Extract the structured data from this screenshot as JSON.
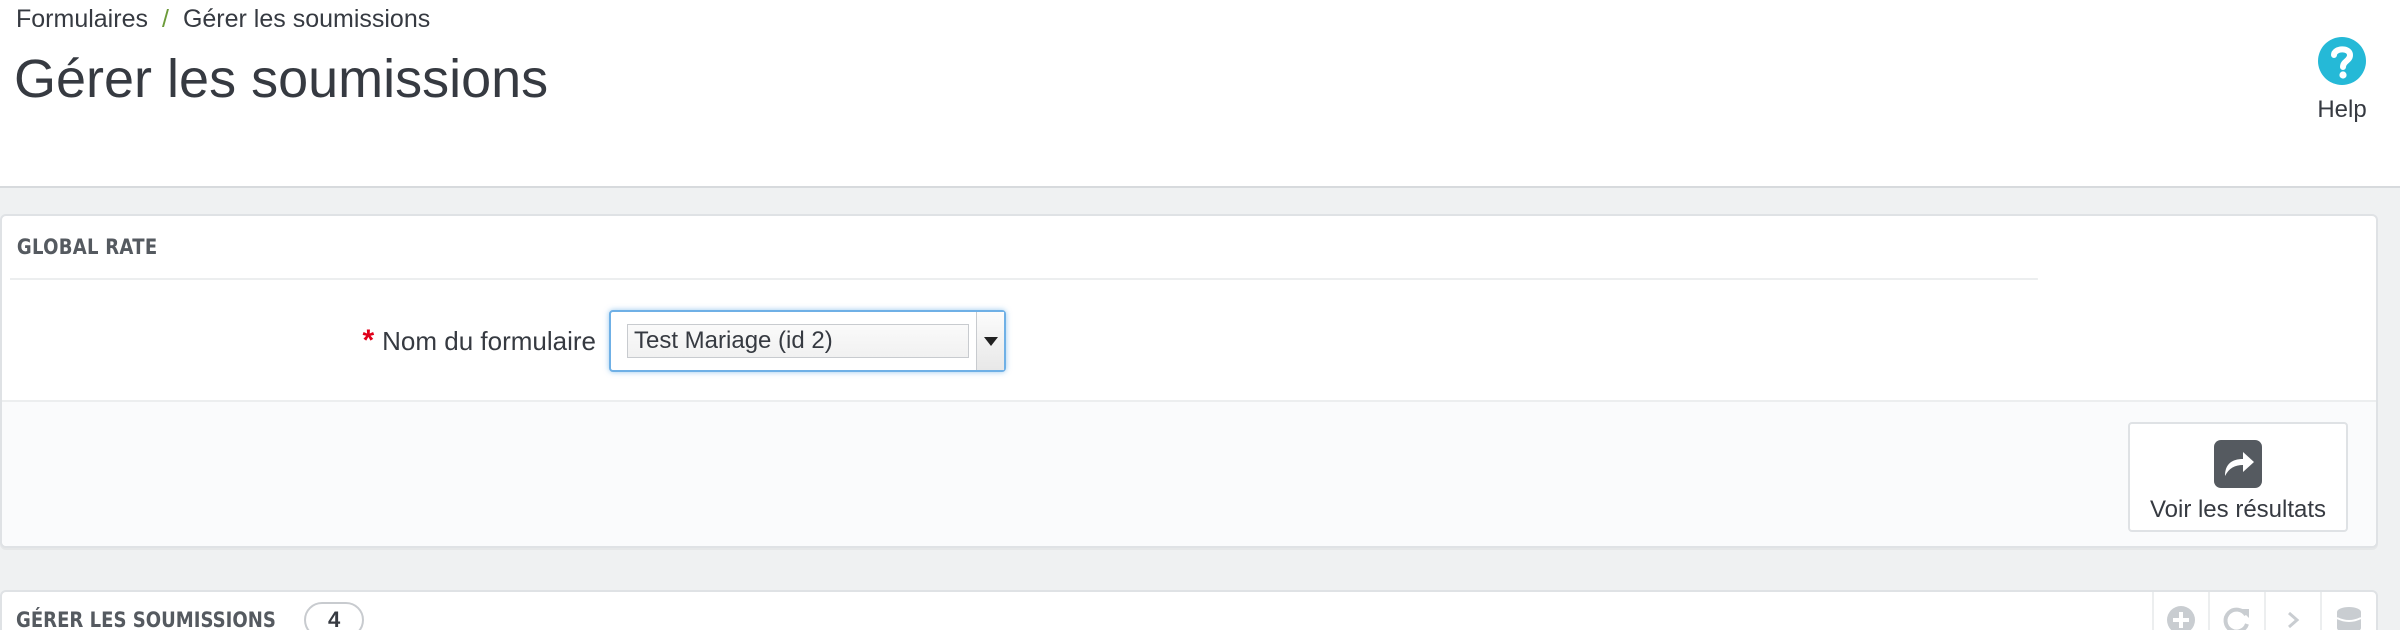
{
  "breadcrumb": {
    "parent": "Formulaires",
    "separator": "/",
    "current": "Gérer les soumissions"
  },
  "page": {
    "title": "Gérer les soumissions"
  },
  "help": {
    "label": "Help",
    "icon": "help-icon"
  },
  "global_rate": {
    "heading": "GLOBAL RATE",
    "form_name": {
      "required_mark": "*",
      "label": "Nom du formulaire",
      "selected": "Test Mariage (id 2)"
    },
    "results_button": {
      "label": "Voir les résultats",
      "icon": "share-icon"
    }
  },
  "submissions": {
    "heading": "GÉRER LES SOUMISSIONS",
    "count": "4",
    "toolbar": [
      {
        "name": "add-icon"
      },
      {
        "name": "refresh-icon"
      },
      {
        "name": "chevron-right-icon"
      },
      {
        "name": "database-icon"
      }
    ]
  },
  "colors": {
    "accent": "#25b9d7",
    "required": "#e0001a",
    "breadcrumb_sep": "#6c9b3a",
    "focus": "#6fb0e6"
  }
}
